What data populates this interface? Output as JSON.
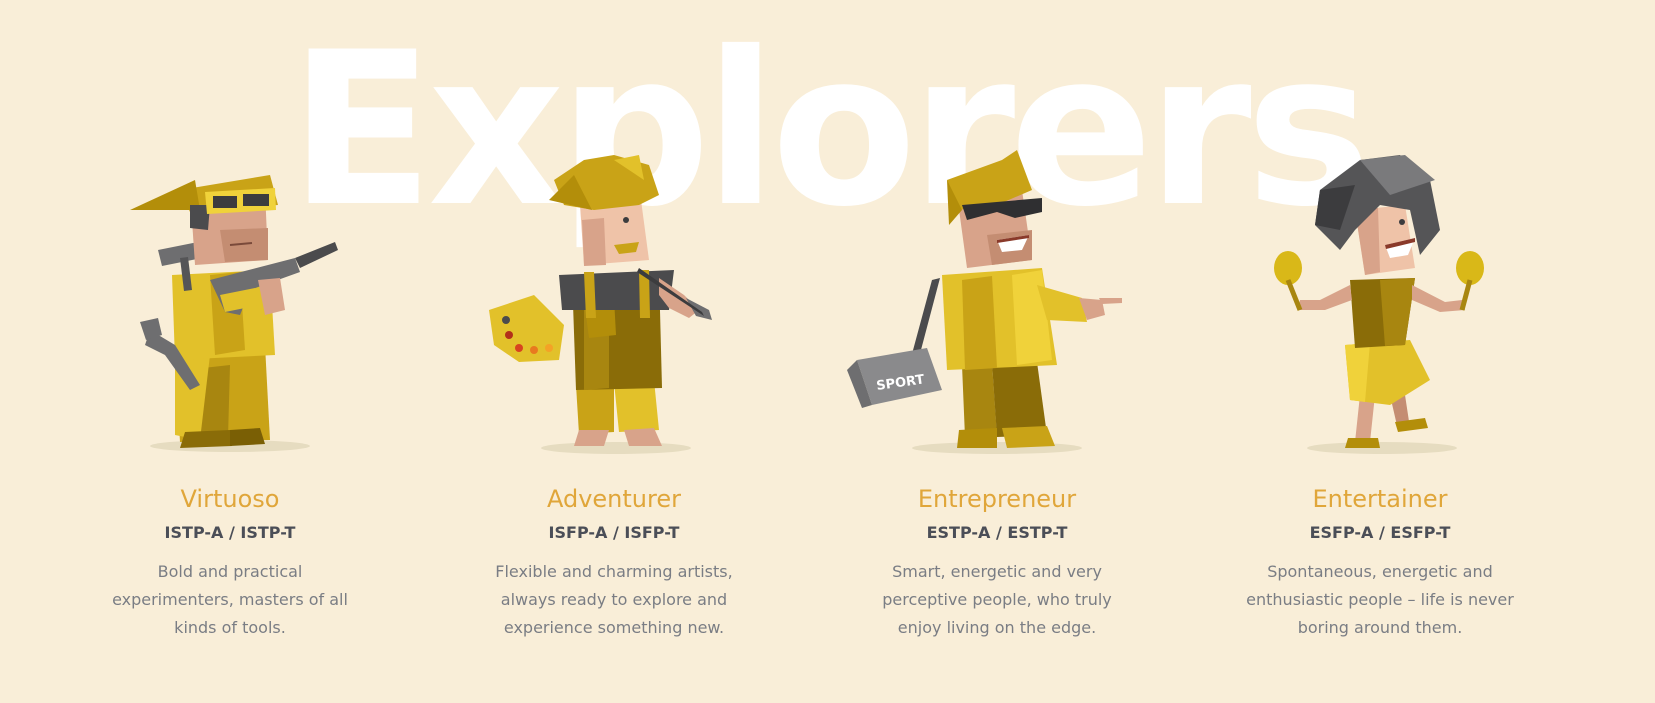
{
  "heading": "Explorers",
  "colors": {
    "background": "#f9eed8",
    "accent_title": "#e0a63a",
    "code_text": "#4b4e57",
    "body_text": "#7a7d84",
    "figure_yellow": "#e2c12a",
    "figure_dark_yellow": "#b38e0a",
    "figure_gray": "#6e6e70"
  },
  "roles": [
    {
      "name": "Virtuoso",
      "code": "ISTP-A / ISTP-T",
      "description": "Bold and practical experimenters, masters of all kinds of tools.",
      "icon": "virtuoso-figure-icon"
    },
    {
      "name": "Adventurer",
      "code": "ISFP-A / ISFP-T",
      "description": "Flexible and charming artists, always ready to explore and experience something new.",
      "icon": "adventurer-figure-icon"
    },
    {
      "name": "Entrepreneur",
      "code": "ESTP-A / ESTP-T",
      "description": "Smart, energetic and very perceptive people, who truly enjoy living on the edge.",
      "icon": "entrepreneur-figure-icon",
      "bag_label": "SPORT"
    },
    {
      "name": "Entertainer",
      "code": "ESFP-A / ESFP-T",
      "description": "Spontaneous, energetic and enthusiastic people – life is never boring around them.",
      "icon": "entertainer-figure-icon"
    }
  ]
}
